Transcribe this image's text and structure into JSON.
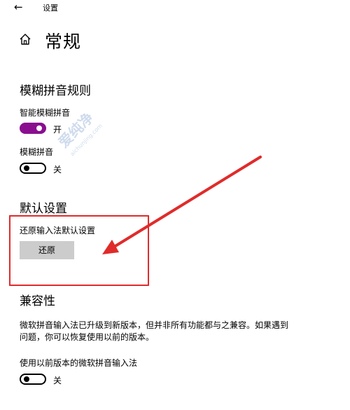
{
  "titlebar": {
    "back_icon": "back-arrow-icon",
    "title": "设置"
  },
  "header": {
    "home_icon": "home-icon",
    "title": "常规"
  },
  "fuzzy_section": {
    "heading": "模糊拼音规则",
    "smart_fuzzy": {
      "label": "智能模糊拼音",
      "state_text": "开",
      "on": true
    },
    "fuzzy": {
      "label": "模糊拼音",
      "state_text": "关",
      "on": false
    }
  },
  "default_section": {
    "heading": "默认设置",
    "restore_label": "还原输入法默认设置",
    "restore_button": "还原"
  },
  "compat_section": {
    "heading": "兼容性",
    "description_line1": "微软拼音输入法已升级到新版本，但并非所有功能都与之兼容。如果遇到",
    "description_line2": "问题，你可以恢复使用以前的版本。",
    "legacy": {
      "label": "使用以前版本的微软拼音输入法",
      "state_text": "关",
      "on": false
    }
  },
  "watermark": {
    "text_cn": "爱纯净",
    "text_en": "aichunjing.com"
  },
  "annotation": {
    "highlight_color": "#e02b2b",
    "accent_color": "#8a0f8f"
  }
}
